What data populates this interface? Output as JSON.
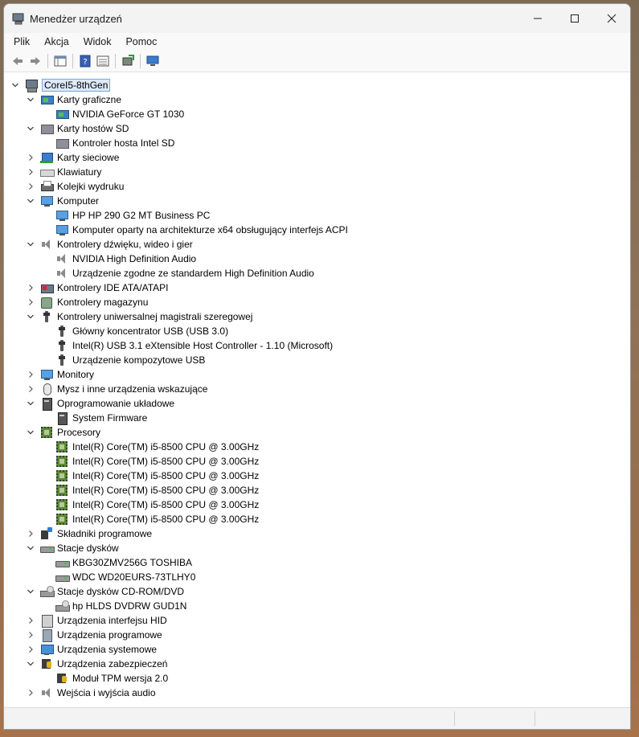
{
  "window": {
    "title": "Menedżer urządzeń",
    "controls": [
      "minimize-icon",
      "maximize-icon",
      "close-icon"
    ]
  },
  "menu": [
    "Plik",
    "Akcja",
    "Widok",
    "Pomoc"
  ],
  "toolbar": [
    "back-arrow-icon",
    "forward-arrow-icon",
    "properties-list-icon",
    "help-icon",
    "view-list-icon",
    "update-driver-icon",
    "scan-hardware-icon"
  ],
  "tree": {
    "root": "CoreI5-8thGen",
    "nodes": [
      {
        "label": "Karty graficzne",
        "icon": "display-adapter-icon",
        "expanded": true,
        "children": [
          {
            "label": "NVIDIA GeForce GT 1030",
            "icon": "display-adapter-icon"
          }
        ]
      },
      {
        "label": "Karty hostów SD",
        "icon": "sd-host-icon",
        "expanded": true,
        "children": [
          {
            "label": "Kontroler hosta Intel SD",
            "icon": "sd-host-icon"
          }
        ]
      },
      {
        "label": "Karty sieciowe",
        "icon": "network-adapter-icon",
        "expanded": false,
        "children": []
      },
      {
        "label": "Klawiatury",
        "icon": "keyboard-icon",
        "expanded": false,
        "children": []
      },
      {
        "label": "Kolejki wydruku",
        "icon": "printer-icon",
        "expanded": false,
        "children": []
      },
      {
        "label": "Komputer",
        "icon": "computer-icon",
        "expanded": true,
        "children": [
          {
            "label": "HP HP 290 G2 MT Business PC",
            "icon": "computer-icon"
          },
          {
            "label": "Komputer oparty na architekturze x64 obsługujący interfejs ACPI",
            "icon": "computer-icon"
          }
        ]
      },
      {
        "label": "Kontrolery dźwięku, wideo i gier",
        "icon": "speaker-icon",
        "expanded": true,
        "children": [
          {
            "label": "NVIDIA High Definition Audio",
            "icon": "speaker-icon"
          },
          {
            "label": "Urządzenie zgodne ze standardem High Definition Audio",
            "icon": "speaker-icon"
          }
        ]
      },
      {
        "label": "Kontrolery IDE ATA/ATAPI",
        "icon": "ide-controller-icon",
        "expanded": false,
        "children": []
      },
      {
        "label": "Kontrolery magazynu",
        "icon": "storage-controller-icon",
        "expanded": false,
        "children": []
      },
      {
        "label": "Kontrolery uniwersalnej magistrali szeregowej",
        "icon": "usb-icon",
        "expanded": true,
        "children": [
          {
            "label": "Główny koncentrator USB (USB 3.0)",
            "icon": "usb-icon"
          },
          {
            "label": "Intel(R) USB 3.1 eXtensible Host Controller - 1.10 (Microsoft)",
            "icon": "usb-icon"
          },
          {
            "label": "Urządzenie kompozytowe USB",
            "icon": "usb-icon"
          }
        ]
      },
      {
        "label": "Monitory",
        "icon": "monitor-icon",
        "expanded": false,
        "children": []
      },
      {
        "label": "Mysz i inne urządzenia wskazujące",
        "icon": "mouse-icon",
        "expanded": false,
        "children": []
      },
      {
        "label": "Oprogramowanie układowe",
        "icon": "firmware-icon",
        "expanded": true,
        "children": [
          {
            "label": "System Firmware",
            "icon": "firmware-icon"
          }
        ]
      },
      {
        "label": "Procesory",
        "icon": "cpu-icon",
        "expanded": true,
        "children": [
          {
            "label": "Intel(R) Core(TM) i5-8500 CPU @ 3.00GHz",
            "icon": "cpu-icon"
          },
          {
            "label": "Intel(R) Core(TM) i5-8500 CPU @ 3.00GHz",
            "icon": "cpu-icon"
          },
          {
            "label": "Intel(R) Core(TM) i5-8500 CPU @ 3.00GHz",
            "icon": "cpu-icon"
          },
          {
            "label": "Intel(R) Core(TM) i5-8500 CPU @ 3.00GHz",
            "icon": "cpu-icon"
          },
          {
            "label": "Intel(R) Core(TM) i5-8500 CPU @ 3.00GHz",
            "icon": "cpu-icon"
          },
          {
            "label": "Intel(R) Core(TM) i5-8500 CPU @ 3.00GHz",
            "icon": "cpu-icon"
          }
        ]
      },
      {
        "label": "Składniki programowe",
        "icon": "software-component-icon",
        "expanded": false,
        "children": []
      },
      {
        "label": "Stacje dysków",
        "icon": "disk-drive-icon",
        "expanded": true,
        "children": [
          {
            "label": "KBG30ZMV256G TOSHIBA",
            "icon": "disk-drive-icon"
          },
          {
            "label": "WDC WD20EURS-73TLHY0",
            "icon": "disk-drive-icon"
          }
        ]
      },
      {
        "label": "Stacje dysków CD-ROM/DVD",
        "icon": "cd-drive-icon",
        "expanded": true,
        "children": [
          {
            "label": "hp HLDS DVDRW  GUD1N",
            "icon": "cd-drive-icon"
          }
        ]
      },
      {
        "label": "Urządzenia interfejsu HID",
        "icon": "hid-icon",
        "expanded": false,
        "children": []
      },
      {
        "label": "Urządzenia programowe",
        "icon": "software-device-icon",
        "expanded": false,
        "children": []
      },
      {
        "label": "Urządzenia systemowe",
        "icon": "system-device-icon",
        "expanded": false,
        "children": []
      },
      {
        "label": "Urządzenia zabezpieczeń",
        "icon": "security-device-icon",
        "expanded": true,
        "children": [
          {
            "label": "Moduł TPM wersja 2.0",
            "icon": "security-device-icon"
          }
        ]
      },
      {
        "label": "Wejścia i wyjścia audio",
        "icon": "audio-io-icon",
        "expanded": false,
        "children": []
      }
    ]
  }
}
